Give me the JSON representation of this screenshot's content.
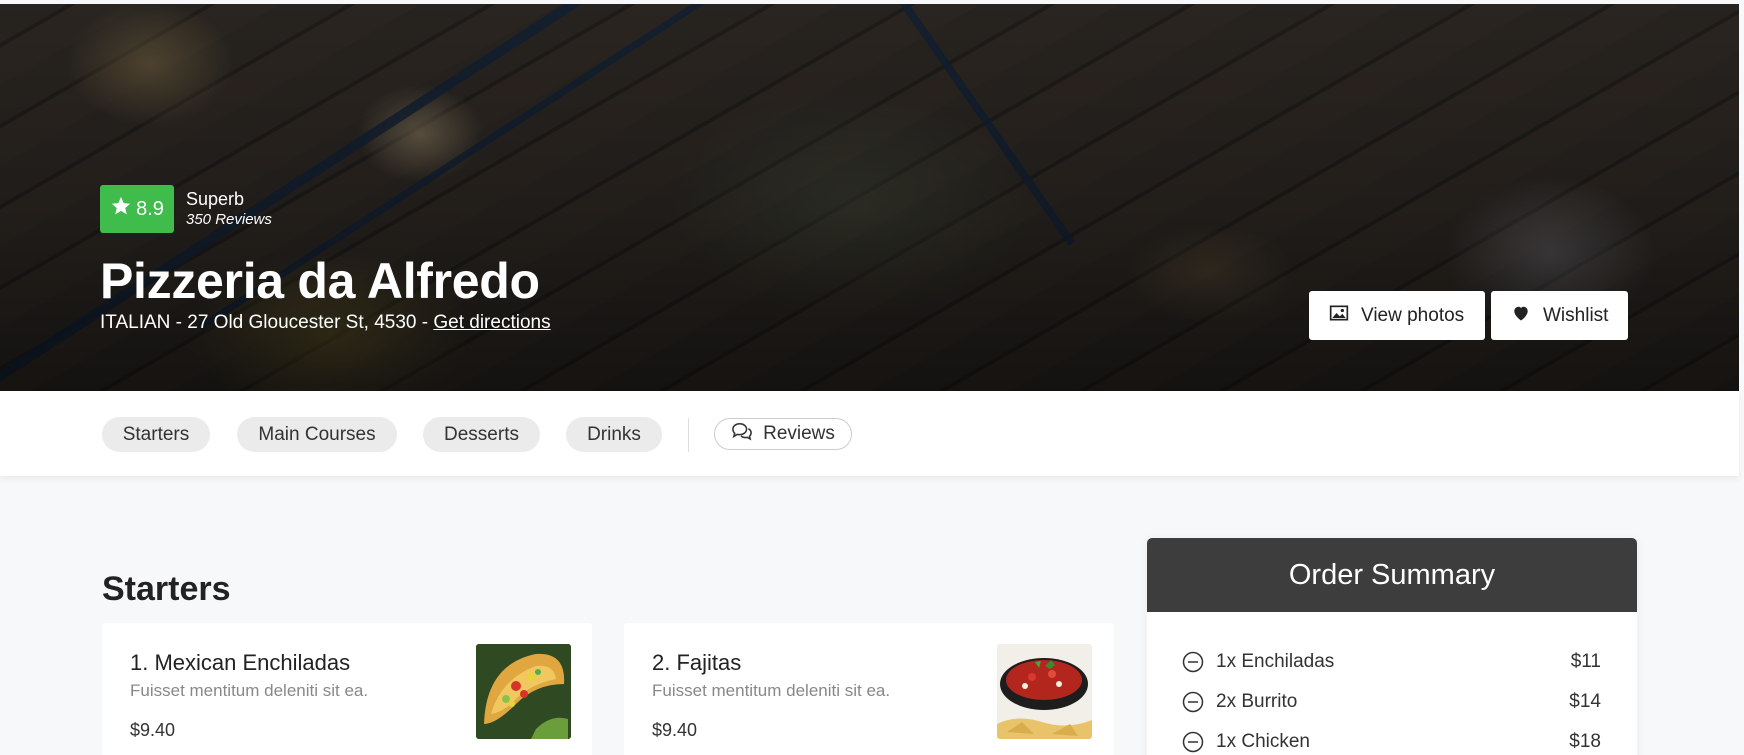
{
  "hero": {
    "rating_value": "8.9",
    "rating_label": "Superb",
    "rating_reviews": "350 Reviews",
    "restaurant_name": "Pizzeria da Alfredo",
    "address_prefix": "ITALIAN - 27 Old Gloucester St, 4530 - ",
    "directions_link": "Get directions",
    "view_photos_label": "View photos",
    "wishlist_label": "Wishlist",
    "badge_color": "#3fbc4b"
  },
  "categories": {
    "items": [
      {
        "label": "Starters"
      },
      {
        "label": "Main Courses"
      },
      {
        "label": "Desserts"
      },
      {
        "label": "Drinks"
      }
    ],
    "reviews_label": "Reviews"
  },
  "menu": {
    "section_title": "Starters",
    "items": [
      {
        "name": "1. Mexican Enchiladas",
        "description": "Fuisset mentitum deleniti sit ea.",
        "price": "$9.40",
        "image_icon": "taco-image"
      },
      {
        "name": "2. Fajitas",
        "description": "Fuisset mentitum deleniti sit ea.",
        "price": "$9.40",
        "image_icon": "salsa-bowl-image"
      }
    ]
  },
  "order_summary": {
    "title": "Order Summary",
    "header_color": "#3d3d3d",
    "items": [
      {
        "label": "1x Enchiladas",
        "price": "$11"
      },
      {
        "label": "2x Burrito",
        "price": "$14"
      },
      {
        "label": "1x Chicken",
        "price": "$18"
      }
    ]
  }
}
